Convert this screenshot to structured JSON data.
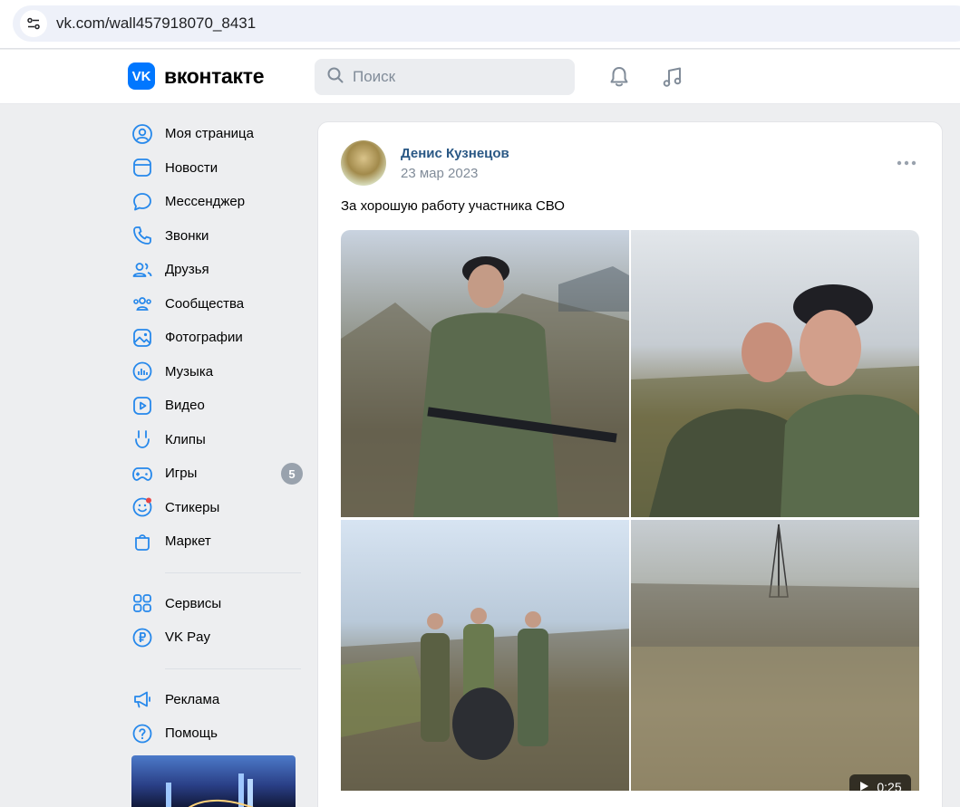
{
  "browser": {
    "url": "vk.com/wall457918070_8431"
  },
  "header": {
    "logo_text": "вконтакте",
    "logo_mark": "VK",
    "search_placeholder": "Поиск"
  },
  "sidebar": {
    "items": [
      {
        "label": "Моя страница",
        "icon": "user-circle-icon"
      },
      {
        "label": "Новости",
        "icon": "newsfeed-icon"
      },
      {
        "label": "Мессенджер",
        "icon": "message-icon"
      },
      {
        "label": "Звонки",
        "icon": "phone-icon"
      },
      {
        "label": "Друзья",
        "icon": "friends-icon"
      },
      {
        "label": "Сообщества",
        "icon": "communities-icon"
      },
      {
        "label": "Фотографии",
        "icon": "photo-icon"
      },
      {
        "label": "Музыка",
        "icon": "music-icon"
      },
      {
        "label": "Видео",
        "icon": "video-icon"
      },
      {
        "label": "Клипы",
        "icon": "clips-icon"
      },
      {
        "label": "Игры",
        "icon": "games-icon",
        "badge": "5"
      },
      {
        "label": "Стикеры",
        "icon": "stickers-icon"
      },
      {
        "label": "Маркет",
        "icon": "market-icon"
      }
    ],
    "items2": [
      {
        "label": "Сервисы",
        "icon": "services-icon"
      },
      {
        "label": "VK Pay",
        "icon": "vkpay-icon"
      }
    ],
    "items3": [
      {
        "label": "Реклама",
        "icon": "megaphone-icon"
      },
      {
        "label": "Помощь",
        "icon": "help-icon"
      }
    ]
  },
  "post": {
    "author": "Денис Кузнецов",
    "date": "23 мар 2023",
    "text": "За хорошую работу участника СВО",
    "video_duration": "0:25"
  },
  "colors": {
    "accent": "#0077ff",
    "link": "#2a5885",
    "muted": "#818c99",
    "icon": "#2688eb",
    "background": "#edeef0"
  }
}
